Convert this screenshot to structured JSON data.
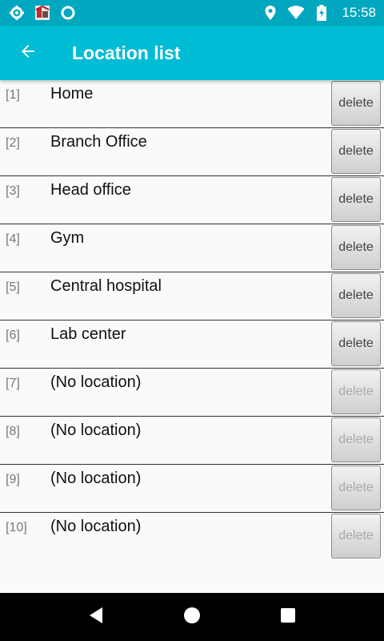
{
  "status_bar": {
    "time": "15:58",
    "left_icons": [
      "settings-icon",
      "app-notification-icon",
      "circle-icon"
    ],
    "right_icons": [
      "location-icon",
      "wifi-icon",
      "battery-charging-icon"
    ]
  },
  "app_bar": {
    "title": "Location list",
    "back_icon": "arrow-back-icon",
    "color": "#00bcd4"
  },
  "locations": [
    {
      "index": "[1]",
      "name": "Home",
      "delete_label": "delete",
      "enabled": true
    },
    {
      "index": "[2]",
      "name": "Branch Office",
      "delete_label": "delete",
      "enabled": true
    },
    {
      "index": "[3]",
      "name": "Head office",
      "delete_label": "delete",
      "enabled": true
    },
    {
      "index": "[4]",
      "name": "Gym",
      "delete_label": "delete",
      "enabled": true
    },
    {
      "index": "[5]",
      "name": "Central hospital",
      "delete_label": "delete",
      "enabled": true
    },
    {
      "index": "[6]",
      "name": "Lab center",
      "delete_label": "delete",
      "enabled": true
    },
    {
      "index": "[7]",
      "name": "(No location)",
      "delete_label": "delete",
      "enabled": false
    },
    {
      "index": "[8]",
      "name": "(No location)",
      "delete_label": "delete",
      "enabled": false
    },
    {
      "index": "[9]",
      "name": "(No location)",
      "delete_label": "delete",
      "enabled": false
    },
    {
      "index": "[10]",
      "name": "(No location)",
      "delete_label": "delete",
      "enabled": false
    }
  ],
  "nav_bar": {
    "icons": [
      "back-triangle-icon",
      "home-circle-icon",
      "recents-square-icon"
    ]
  }
}
